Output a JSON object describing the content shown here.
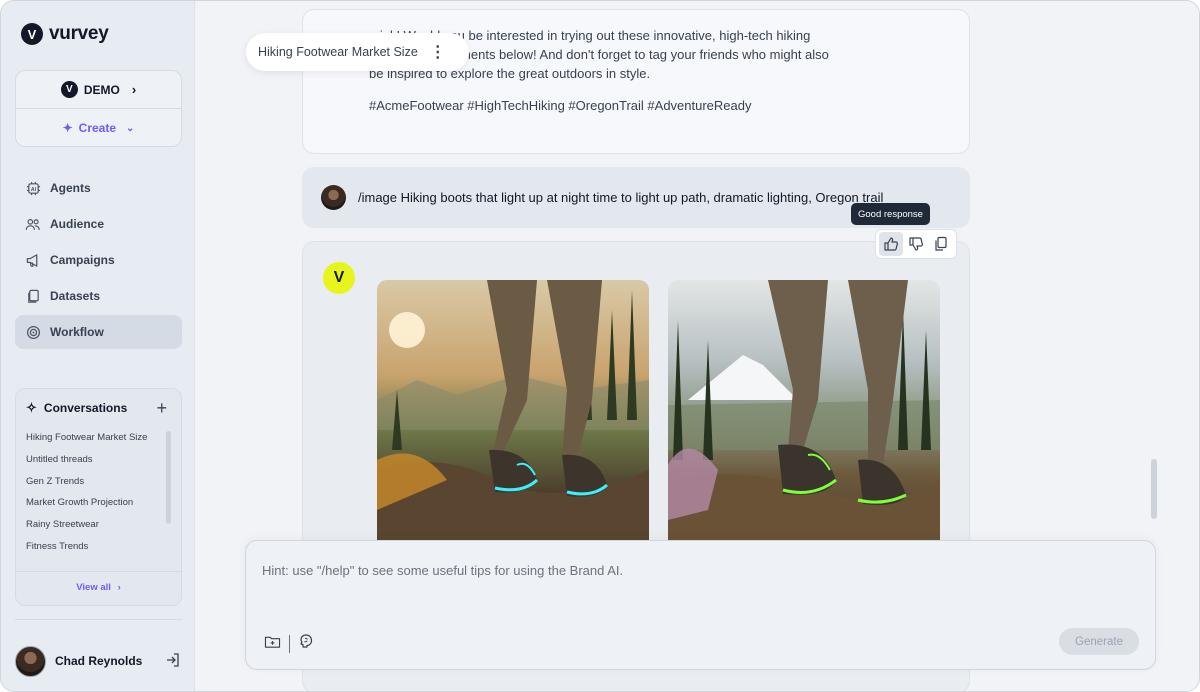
{
  "app": {
    "logo_text": "vurvey",
    "logo_glyph": "V"
  },
  "workspace": {
    "name": "DEMO",
    "create_label": "Create"
  },
  "nav": [
    {
      "label": "Agents",
      "icon": "ai-chip-icon"
    },
    {
      "label": "Audience",
      "icon": "people-icon"
    },
    {
      "label": "Campaigns",
      "icon": "megaphone-icon"
    },
    {
      "label": "Datasets",
      "icon": "files-icon"
    },
    {
      "label": "Workflow",
      "icon": "target-icon",
      "active": true
    }
  ],
  "conversations": {
    "title": "Conversations",
    "items": [
      "Hiking Footwear Market Size",
      "Untitled threads",
      "Gen Z Trends",
      "Market Growth Projection",
      "Rainy Streetwear",
      "Fitness Trends"
    ],
    "view_all": "View all"
  },
  "user": {
    "name": "Chad Reynolds"
  },
  "thread": {
    "title": "Hiking Footwear Market Size",
    "prev_message_line1": "...ink! Would you be interested in trying out these innovative, high-tech hiking",
    "prev_message_line2": "...ow in the comments below! And don't forget to tag your friends who might also",
    "prev_message_line3": "be inspired to explore the great outdoors in style.",
    "hashtags": "#AcmeFootwear #HighTechHiking #OregonTrail #AdventureReady",
    "prompt": "/image Hiking boots that light up at night time to light up path, dramatic lighting, Oregon trail",
    "tooltip": "Good response",
    "ai_glyph": "V"
  },
  "composer": {
    "placeholder": "Hint: use \"/help\" to see some useful tips for using the Brand AI.",
    "generate_label": "Generate"
  },
  "colors": {
    "accent": "#6d5dfc",
    "ai_badge": "#e8f51a"
  }
}
